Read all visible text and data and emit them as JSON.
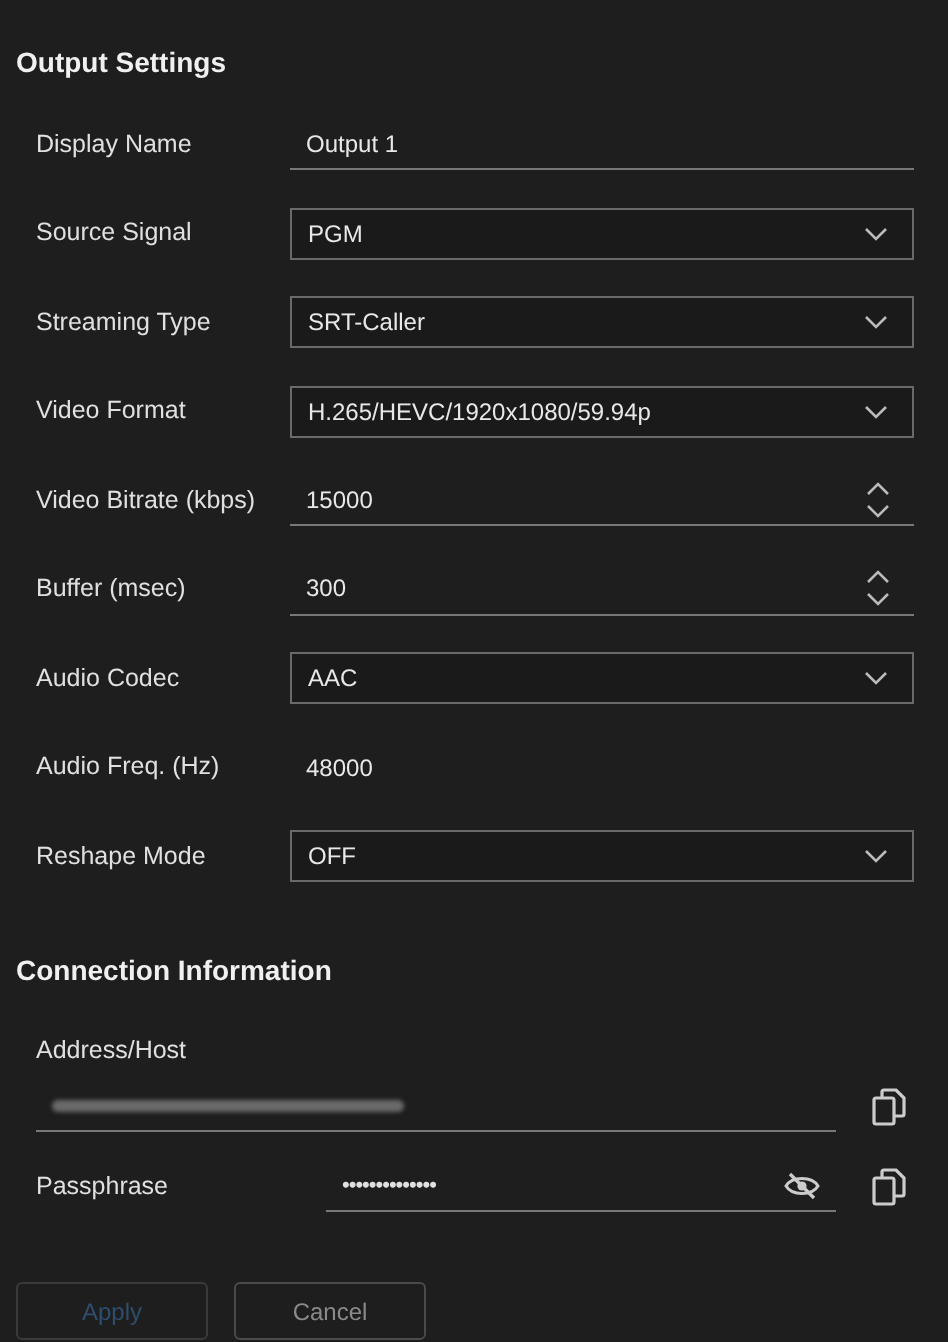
{
  "output_settings": {
    "title": "Output Settings",
    "fields": [
      {
        "label": "Display Name",
        "kind": "text",
        "value": "Output 1"
      },
      {
        "label": "Source Signal",
        "kind": "select",
        "value": "PGM"
      },
      {
        "label": "Streaming Type",
        "kind": "select",
        "value": "SRT-Caller"
      },
      {
        "label": "Video Format",
        "kind": "select",
        "value": "H.265/HEVC/1920x1080/59.94p"
      },
      {
        "label": "Video Bitrate (kbps)",
        "kind": "number",
        "value": "15000"
      },
      {
        "label": "Buffer (msec)",
        "kind": "number",
        "value": "300"
      },
      {
        "label": "Audio Codec",
        "kind": "select",
        "value": "AAC"
      },
      {
        "label": "Audio Freq. (Hz)",
        "kind": "static",
        "value": "48000"
      },
      {
        "label": "Reshape Mode",
        "kind": "select",
        "value": "OFF"
      }
    ]
  },
  "connection_information": {
    "title": "Connection Information",
    "address": {
      "label": "Address/Host",
      "redacted": true
    },
    "passphrase": {
      "label": "Passphrase",
      "value": "••••••••••••••"
    }
  },
  "buttons": [
    {
      "label": "Apply",
      "disabled": true
    },
    {
      "label": "Cancel",
      "disabled": false
    }
  ]
}
